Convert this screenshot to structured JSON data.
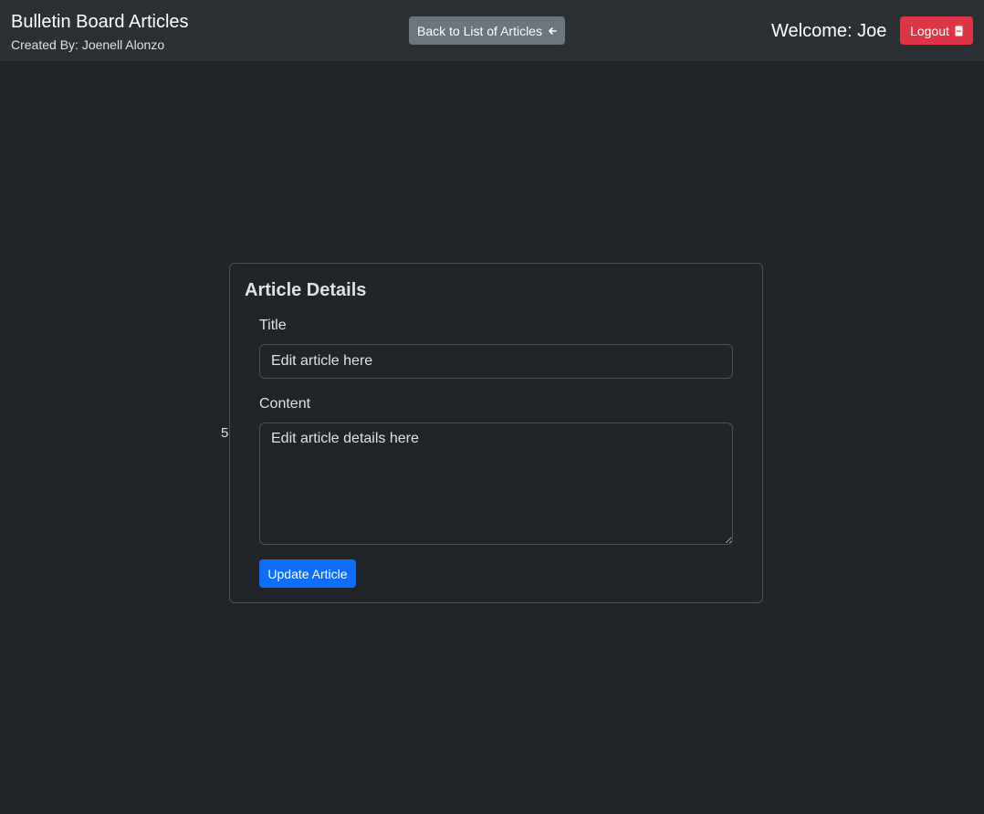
{
  "navbar": {
    "brand_title": "Bulletin Board Articles",
    "brand_subtitle": "Created By: Joenell Alonzo",
    "back_button_label": "Back to List of Articles",
    "back_icon": "arrow-left-icon",
    "welcome_text": "Welcome: Joe",
    "logout_label": "Logout",
    "logout_icon": "door-icon"
  },
  "stray_text": "5",
  "card": {
    "heading": "Article Details",
    "title_label": "Title",
    "title_value": "Edit article here",
    "content_label": "Content",
    "content_value": "Edit article details here",
    "submit_label": "Update Article"
  },
  "colors": {
    "background": "#212529",
    "navbar": "#2b3035",
    "secondary": "#6c757d",
    "danger": "#dc3545",
    "primary": "#0d6efd"
  }
}
